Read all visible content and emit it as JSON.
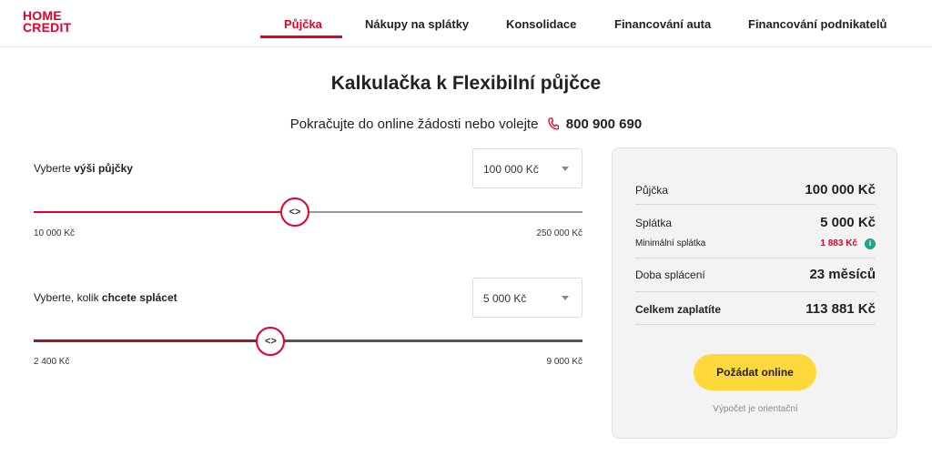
{
  "header": {
    "logo_line1": "HOME",
    "logo_line2": "CREDIT",
    "nav": [
      {
        "label": "Půjčka",
        "active": true
      },
      {
        "label": "Nákupy na splátky"
      },
      {
        "label": "Konsolidace"
      },
      {
        "label": "Financování auta"
      },
      {
        "label": "Financování podnikatelů"
      }
    ]
  },
  "main": {
    "title": "Kalkulačka k Flexibilní půjčce",
    "subtitle_text": "Pokračujte do online žádosti nebo volejte",
    "phone": "800 900 690"
  },
  "loan_slider": {
    "label_prefix": "Vyberte ",
    "label_bold": "výši půjčky",
    "selected": "100 000 Kč",
    "min_label": "10 000 Kč",
    "max_label": "250 000 Kč",
    "value_fraction": 0.476
  },
  "payment_slider": {
    "label_prefix": "Vyberte, kolik ",
    "label_bold": "chcete splácet",
    "selected": "5 000 Kč",
    "min_label": "2 400 Kč",
    "max_label": "9 000 Kč",
    "value_fraction": 0.432
  },
  "summary": {
    "loan_label": "Půjčka",
    "loan_value": "100 000 Kč",
    "installment_label": "Splátka",
    "installment_value": "5 000 Kč",
    "min_installment_label": "Minimální splátka",
    "min_installment_value": "1 883 Kč",
    "duration_label": "Doba splácení",
    "duration_value": "23 měsíců",
    "total_label": "Celkem zaplatíte",
    "total_value": "113 881 Kč",
    "cta_label": "Požádat online",
    "note": "Výpočet je orientační"
  },
  "colors": {
    "brand_red": "#e4002b",
    "cta_yellow": "#ffd83b",
    "info_green": "#22a586"
  }
}
